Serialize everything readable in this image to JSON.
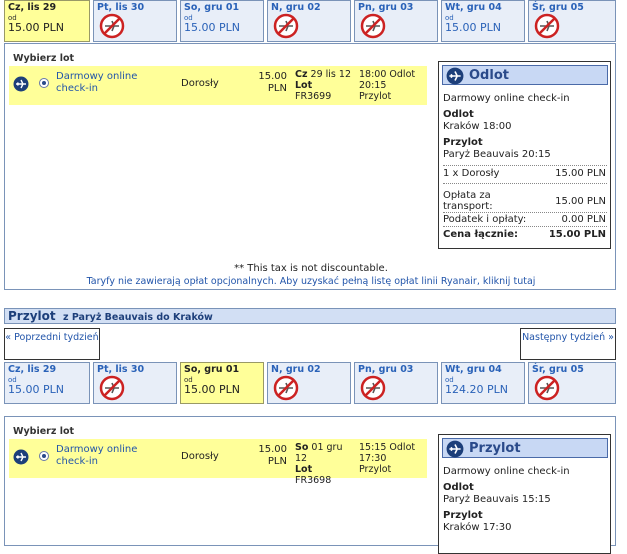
{
  "outbound": {
    "days": [
      {
        "label": "Cz, lis 29",
        "od": "od",
        "price": "15.00 PLN",
        "available": true,
        "selected": true
      },
      {
        "label": "Pt, lis 30",
        "available": false
      },
      {
        "label": "So, gru 01",
        "od": "od",
        "price": "15.00 PLN",
        "available": true
      },
      {
        "label": "N, gru 02",
        "available": false
      },
      {
        "label": "Pn, gru 03",
        "available": false
      },
      {
        "label": "Wt, gru 04",
        "od": "od",
        "price": "15.00 PLN",
        "available": true
      },
      {
        "label": "Śr, gru 05",
        "available": false
      }
    ],
    "select_label": "Wybierz lot",
    "flight": {
      "checkin": "Darmowy online check-in",
      "passenger": "Dorosły",
      "price_amount": "15.00",
      "price_currency": "PLN",
      "date_prefix": "Cz",
      "date": "29 lis 12",
      "lot_label": "Lot",
      "flight_no": "FR3699",
      "dep_time": "18:00",
      "dep_label": "Odlot",
      "arr_time": "20:15",
      "arr_label": "Przylot"
    },
    "summary": {
      "title": "Odlot",
      "checkin": "Darmowy online check-in",
      "dep_heading": "Odlot",
      "dep_value": "Kraków 18:00",
      "arr_heading": "Przylot",
      "arr_value": "Paryż Beauvais 20:15",
      "pax_label": "1 x Dorosły",
      "pax_price": "15.00 PLN",
      "transport_label": "Opłata za transport:",
      "transport_price": "15.00 PLN",
      "tax_label": "Podatek i opłaty:",
      "tax_price": "0.00 PLN",
      "total_label": "Cena łącznie:",
      "total_price": "15.00 PLN"
    },
    "tax_note": "** This tax is not discountable.",
    "fees_note": "Taryfy nie zawierają opłat opcjonalnych. Aby uzyskać pełną listę opłat linii Ryanair, kliknij tutaj"
  },
  "return": {
    "title": "Przylot",
    "route": "z Paryż Beauvais do Kraków",
    "prev_week": "« Poprzedni tydzień",
    "next_week": "Następny tydzień »",
    "days": [
      {
        "label": "Cz, lis 29",
        "od": "od",
        "price": "15.00 PLN",
        "available": true
      },
      {
        "label": "Pt, lis 30",
        "available": false
      },
      {
        "label": "So, gru 01",
        "od": "od",
        "price": "15.00 PLN",
        "available": true,
        "selected": true
      },
      {
        "label": "N, gru 02",
        "available": false
      },
      {
        "label": "Pn, gru 03",
        "available": false
      },
      {
        "label": "Wt, gru 04",
        "od": "od",
        "price": "124.20 PLN",
        "available": true
      },
      {
        "label": "Śr, gru 05",
        "available": false
      }
    ],
    "select_label": "Wybierz lot",
    "flight": {
      "checkin": "Darmowy online check-in",
      "passenger": "Dorosły",
      "price_amount": "15.00",
      "price_currency": "PLN",
      "date_prefix": "So",
      "date": "01 gru 12",
      "lot_label": "Lot",
      "flight_no": "FR3698",
      "dep_time": "15:15",
      "dep_label": "Odlot",
      "arr_time": "17:30",
      "arr_label": "Przylot"
    },
    "summary": {
      "title": "Przylot",
      "checkin": "Darmowy online check-in",
      "dep_heading": "Odlot",
      "dep_value": "Paryż Beauvais 15:15",
      "arr_heading": "Przylot",
      "arr_value": "Kraków 17:30"
    }
  },
  "colors": {
    "accent": "#2a62b8",
    "selected_bg": "#ffff99",
    "no_flight": "#cc2222"
  }
}
